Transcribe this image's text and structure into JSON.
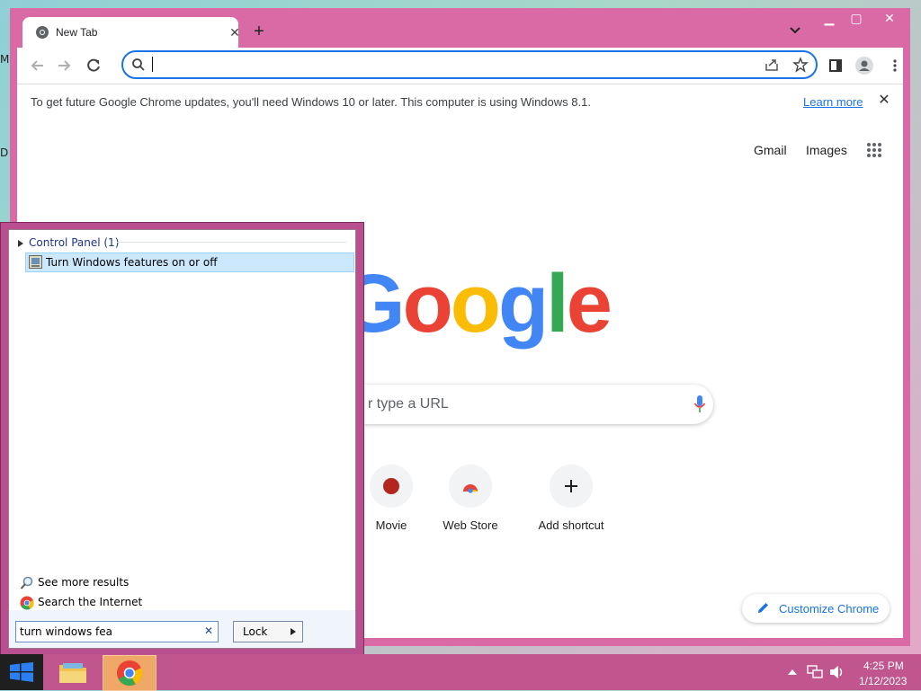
{
  "desktop": {
    "edge_glyphs": [
      "M",
      "D"
    ]
  },
  "browser": {
    "tab_title": "New Tab",
    "omnibox_value": "",
    "infobar": {
      "message": "To get future Google Chrome updates, you'll need Windows 10 or later. This computer is using Windows 8.1.",
      "link": "Learn more"
    },
    "ntp": {
      "gmail": "Gmail",
      "images": "Images",
      "logo_letters": [
        "G",
        "o",
        "o",
        "g",
        "l",
        "e"
      ],
      "search_placeholder": "Search Google or type a URL",
      "search_placeholder_visible": "r type a URL",
      "shortcuts": [
        {
          "label": "Movie"
        },
        {
          "label": "Web Store"
        },
        {
          "label": "Add shortcut"
        }
      ],
      "customize": "Customize Chrome"
    }
  },
  "start_search": {
    "group_header": "Control Panel (1)",
    "result": "Turn Windows features on or off",
    "see_more": "See more results",
    "search_internet": "Search the Internet",
    "query": "turn windows fea",
    "lock": "Lock"
  },
  "taskbar": {
    "time": "4:25 PM",
    "date": "1/12/2023"
  },
  "colors": {
    "window_frame": "#d96aa6",
    "taskbar": "#c1558d",
    "accent": "#1a73e8",
    "google_blue": "#4285f4",
    "google_red": "#ea4335",
    "google_yellow": "#fbbc05",
    "google_green": "#34a853"
  }
}
